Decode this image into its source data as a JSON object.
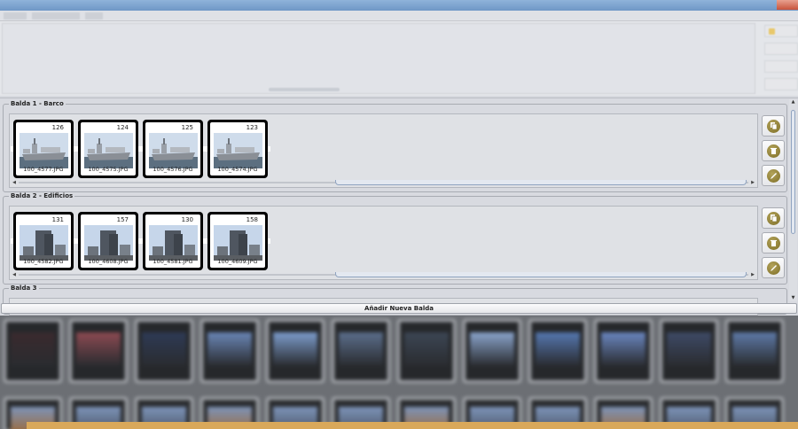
{
  "shelves": [
    {
      "title": "Balda 1 - Barco",
      "photos": [
        {
          "count": "126",
          "filename": "100_4577.JPG",
          "kind": "ship"
        },
        {
          "count": "124",
          "filename": "100_4575.JPG",
          "kind": "ship"
        },
        {
          "count": "125",
          "filename": "100_4576.JPG",
          "kind": "ship"
        },
        {
          "count": "123",
          "filename": "100_4574.JPG",
          "kind": "ship"
        }
      ]
    },
    {
      "title": "Balda 2 - Edificios",
      "photos": [
        {
          "count": "131",
          "filename": "100_4582.JPG",
          "kind": "building"
        },
        {
          "count": "157",
          "filename": "100_4608.JPG",
          "kind": "building"
        },
        {
          "count": "130",
          "filename": "100_4581.JPG",
          "kind": "building"
        },
        {
          "count": "158",
          "filename": "100_4609.JPG",
          "kind": "building"
        }
      ]
    },
    {
      "title": "Balda 3",
      "photos": []
    }
  ],
  "shelf_tools": {
    "copy_icon": "copy-icon",
    "delete_icon": "trash-icon",
    "edit_icon": "pencil-icon"
  },
  "add_shelf_label": "Añadir Nueva Balda",
  "colors": {
    "tool_icon": "#8b7b32",
    "scroll_accent": "#8fa3c0",
    "title_bar": "#7fa6d2"
  }
}
